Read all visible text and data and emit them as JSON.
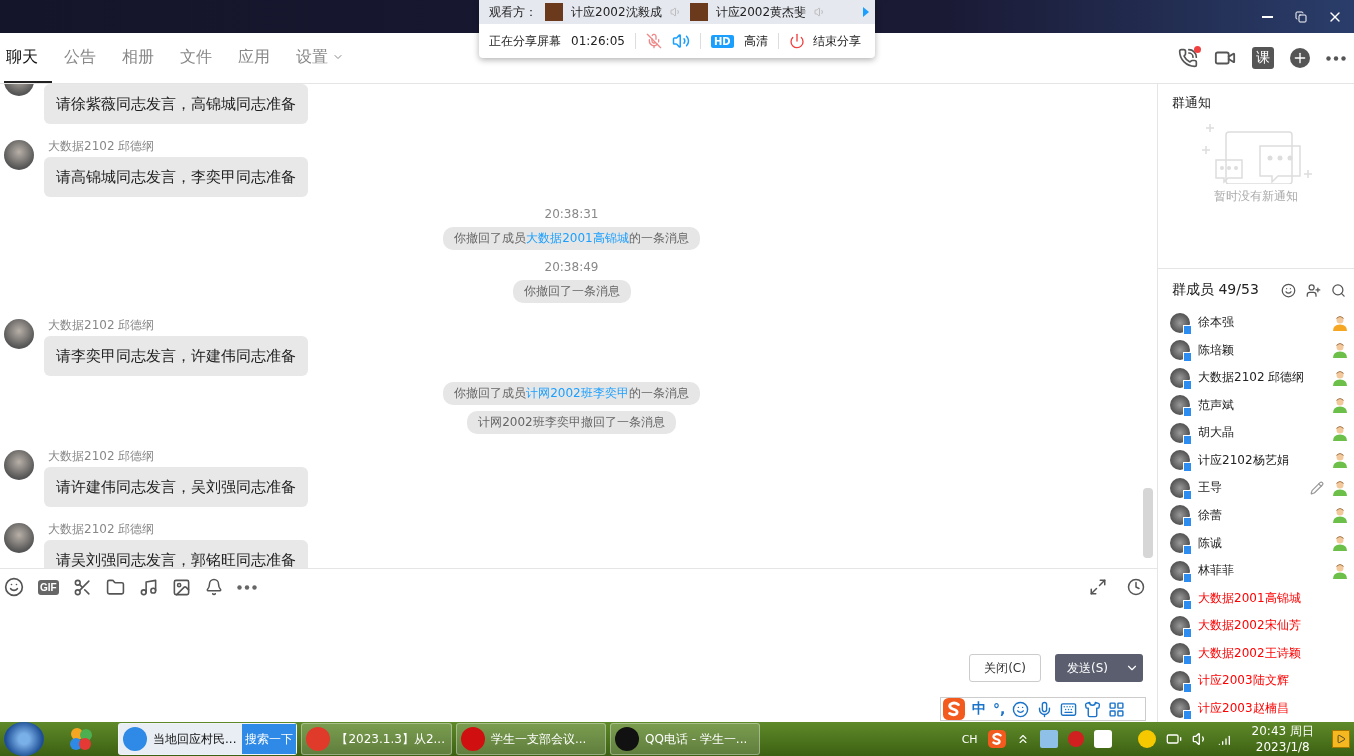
{
  "share_panel": {
    "viewers_label": "观看方：",
    "viewers": [
      {
        "name": "计应2002沈毅成"
      },
      {
        "name": "计应2002黄杰斐"
      }
    ],
    "status": "正在分享屏幕",
    "duration": "01:26:05",
    "mic_muted": true,
    "hd_badge": "HD",
    "quality": "高清",
    "end_label": "结束分享"
  },
  "tabs": [
    {
      "label": "聊天",
      "selected": true,
      "dropdown": false
    },
    {
      "label": "公告",
      "selected": false,
      "dropdown": false
    },
    {
      "label": "相册",
      "selected": false,
      "dropdown": false
    },
    {
      "label": "文件",
      "selected": false,
      "dropdown": false
    },
    {
      "label": "应用",
      "selected": false,
      "dropdown": false
    },
    {
      "label": "设置",
      "selected": false,
      "dropdown": true
    }
  ],
  "header_actions": {
    "lesson_label": "课"
  },
  "messages": [
    {
      "kind": "message",
      "text": "请徐紫薇同志发言，高锦城同志准备"
    },
    {
      "kind": "message",
      "sender": "大数据2102 邱德纲",
      "text": "请高锦城同志发言，李奕甲同志准备"
    },
    {
      "kind": "time",
      "text": "20:38:31"
    },
    {
      "kind": "notice",
      "before": "你撤回了成员",
      "link": "大数据2001高锦城",
      "after": "的一条消息"
    },
    {
      "kind": "time",
      "text": "20:38:49"
    },
    {
      "kind": "notice",
      "before": "你撤回了一条消息"
    },
    {
      "kind": "message",
      "sender": "大数据2102 邱德纲",
      "text": "请李奕甲同志发言，许建伟同志准备"
    },
    {
      "kind": "notice",
      "before": "你撤回了成员",
      "link": "计网2002班李奕甲",
      "after": "的一条消息"
    },
    {
      "kind": "notice",
      "before": "计网2002班李奕甲撤回了一条消息"
    },
    {
      "kind": "message",
      "sender": "大数据2102 邱德纲",
      "text": "请许建伟同志发言，吴刘强同志准备"
    },
    {
      "kind": "message",
      "sender": "大数据2102 邱德纲",
      "text": "请吴刘强同志发言，郭铭旺同志准备"
    }
  ],
  "toolbar": {
    "gif_label": "GIF"
  },
  "input_buttons": {
    "close": "关闭(C)",
    "send": "发送(S)"
  },
  "notice_panel": {
    "title": "群通知",
    "empty_text": "暂时没有新通知"
  },
  "members": {
    "title": "群成员 49/53",
    "items": [
      {
        "name": "徐本强",
        "highlighted": false,
        "owner": true,
        "admin": false,
        "editable": false
      },
      {
        "name": "陈培颖",
        "highlighted": false,
        "owner": false,
        "admin": true,
        "editable": false
      },
      {
        "name": "大数据2102 邱德纲",
        "highlighted": false,
        "owner": false,
        "admin": true,
        "editable": false
      },
      {
        "name": "范声斌",
        "highlighted": false,
        "owner": false,
        "admin": true,
        "editable": false
      },
      {
        "name": "胡大晶",
        "highlighted": false,
        "owner": false,
        "admin": true,
        "editable": false
      },
      {
        "name": "计应2102杨艺娟",
        "highlighted": false,
        "owner": false,
        "admin": true,
        "editable": false
      },
      {
        "name": "王导",
        "highlighted": false,
        "owner": false,
        "admin": true,
        "editable": true
      },
      {
        "name": "徐蕾",
        "highlighted": false,
        "owner": false,
        "admin": true,
        "editable": false
      },
      {
        "name": "陈诚",
        "highlighted": false,
        "owner": false,
        "admin": true,
        "editable": false
      },
      {
        "name": "林菲菲",
        "highlighted": false,
        "owner": false,
        "admin": true,
        "editable": false
      },
      {
        "name": "大数据2001高锦城",
        "highlighted": true,
        "owner": false,
        "admin": false,
        "editable": false
      },
      {
        "name": "大数据2002宋仙芳",
        "highlighted": true,
        "owner": false,
        "admin": false,
        "editable": false
      },
      {
        "name": "大数据2002王诗颖",
        "highlighted": true,
        "owner": false,
        "admin": false,
        "editable": false
      },
      {
        "name": "计应2003陆文辉",
        "highlighted": true,
        "owner": false,
        "admin": false,
        "editable": false
      },
      {
        "name": "计应2003赵楠昌",
        "highlighted": true,
        "owner": false,
        "admin": false,
        "editable": false
      }
    ]
  },
  "ime_bar": {
    "mode": "中",
    "punct": "°,"
  },
  "taskbar": {
    "tasks": [
      {
        "kind": "browser",
        "label": "当地回应村民...",
        "extra": "搜索一下"
      },
      {
        "kind": "office",
        "label": "【2023.1.3】从2..."
      },
      {
        "kind": "party",
        "label": "学生一支部会议..."
      },
      {
        "kind": "qq",
        "label": "QQ电话 - 学生一..."
      }
    ],
    "lang": "CH",
    "time": "20:43 周日",
    "date": "2023/1/8"
  }
}
